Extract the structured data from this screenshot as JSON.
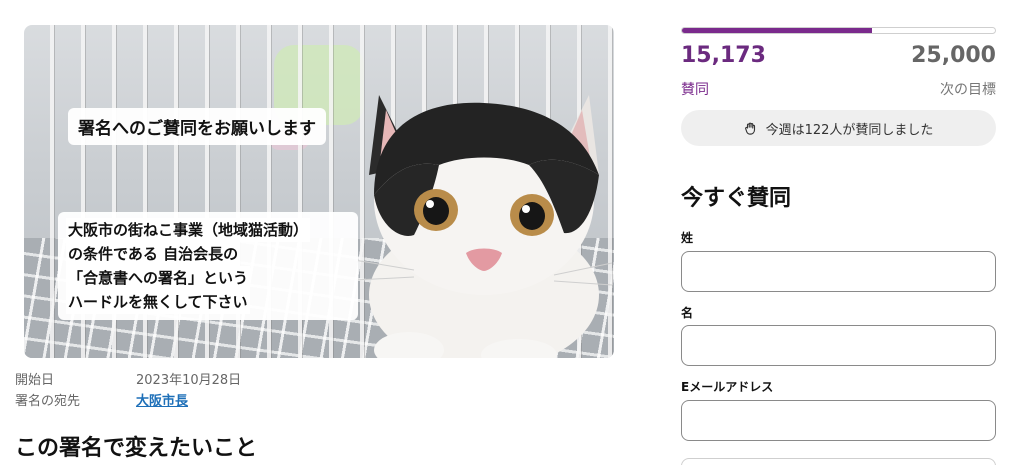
{
  "hero": {
    "caption_top": "署名へのご賛同をお願いします",
    "caption_lines": [
      "大阪市の街ねこ事業（地域猫活動）",
      "の条件である 自治会長の",
      "「合意書への署名」という",
      "ハードルを無くして下さい"
    ]
  },
  "meta": {
    "start_label": "開始日",
    "start_value": "2023年10月28日",
    "target_label": "署名の宛先",
    "target_value": "大阪市長"
  },
  "section_title": "この署名で変えたいこと",
  "progress": {
    "current": "15,173",
    "current_label": "賛同",
    "goal": "25,000",
    "goal_label": "次の目標",
    "fraction": 0.607,
    "accent": "#7a2a8c"
  },
  "week_pill": {
    "icon": "hand-wave-icon",
    "text": "今週は122人が賛同しました"
  },
  "sign_form": {
    "title": "今すぐ賛同",
    "last_name_label": "姓",
    "last_name_value": "",
    "first_name_label": "名",
    "first_name_value": "",
    "email_label": "Eメールアドレス",
    "email_value": ""
  }
}
